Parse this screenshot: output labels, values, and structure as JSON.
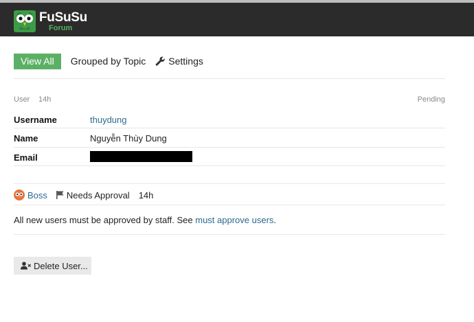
{
  "brand": {
    "name": "FuSuSu",
    "sub": "Forum",
    "logo_icon": "owl-logo-icon",
    "accent_color": "#5cb065",
    "header_color": "#2b2b2b"
  },
  "tabs": {
    "view_all": "View All",
    "grouped_by_topic": "Grouped by Topic",
    "settings": "Settings",
    "settings_icon": "wrench-icon"
  },
  "review": {
    "type": "User",
    "age": "14h",
    "status": "Pending",
    "fields": {
      "username_label": "Username",
      "username_value": "thuydung",
      "name_label": "Name",
      "name_value": "Nguyễn Thùy Dung",
      "email_label": "Email"
    },
    "reviewer": {
      "name": "Boss",
      "avatar_icon": "owl-avatar-icon",
      "flag_icon": "flag-icon",
      "reason": "Needs Approval",
      "time": "14h"
    },
    "message": {
      "prefix": "All new users must be approved by staff. See ",
      "link": "must approve users",
      "suffix": "."
    },
    "delete_button": {
      "label": "Delete User...",
      "icon": "user-remove-icon"
    }
  }
}
